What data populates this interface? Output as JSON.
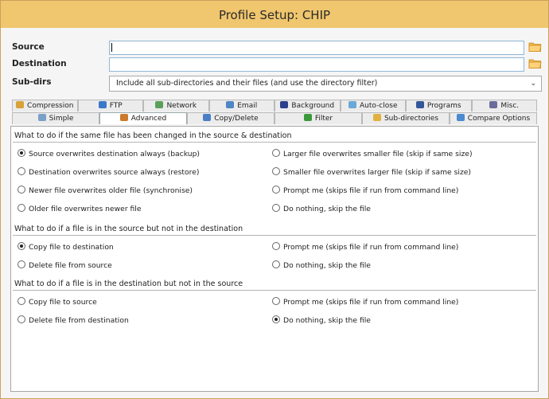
{
  "window": {
    "title": "Profile Setup: CHIP"
  },
  "fields": {
    "source_label": "Source",
    "destination_label": "Destination",
    "subdirs_label": "Sub-dirs",
    "source_value": "",
    "destination_value": "",
    "subdirs_value": "Include all sub-directories and their files (and use the directory filter)"
  },
  "tabs_top": [
    {
      "label": "Compression",
      "icon": "compression-icon"
    },
    {
      "label": "FTP",
      "icon": "ftp-icon"
    },
    {
      "label": "Network",
      "icon": "network-icon"
    },
    {
      "label": "Email",
      "icon": "email-icon"
    },
    {
      "label": "Background",
      "icon": "background-icon"
    },
    {
      "label": "Auto-close",
      "icon": "auto-close-icon"
    },
    {
      "label": "Programs",
      "icon": "programs-icon"
    },
    {
      "label": "Misc.",
      "icon": "misc-icon"
    }
  ],
  "tabs_bottom": [
    {
      "label": "Simple",
      "icon": "simple-icon"
    },
    {
      "label": "Advanced",
      "icon": "advanced-icon",
      "active": true
    },
    {
      "label": "Copy/Delete",
      "icon": "copy-delete-icon"
    },
    {
      "label": "Filter",
      "icon": "filter-icon"
    },
    {
      "label": "Sub-directories",
      "icon": "sub-directories-icon"
    },
    {
      "label": "Compare Options",
      "icon": "compare-options-icon"
    }
  ],
  "sections": [
    {
      "heading": "What to do if the same file has been changed in the source & destination",
      "options": [
        {
          "label": "Source overwrites destination always (backup)",
          "checked": true
        },
        {
          "label": "Larger file overwrites smaller file (skip if same size)",
          "checked": false
        },
        {
          "label": "Destination overwrites source always (restore)",
          "checked": false
        },
        {
          "label": "Smaller file overwrites larger file (skip if same size)",
          "checked": false
        },
        {
          "label": "Newer file overwrites older file (synchronise)",
          "checked": false
        },
        {
          "label": "Prompt me (skips file if run from command line)",
          "checked": false
        },
        {
          "label": "Older file overwrites newer file",
          "checked": false
        },
        {
          "label": "Do nothing, skip the file",
          "checked": false
        }
      ]
    },
    {
      "heading": "What to do if a file is in the source but not in the destination",
      "options": [
        {
          "label": "Copy file to destination",
          "checked": true
        },
        {
          "label": "Prompt me  (skips file if run from command line)",
          "checked": false
        },
        {
          "label": "Delete file from source",
          "checked": false
        },
        {
          "label": "Do nothing, skip the file",
          "checked": false
        }
      ]
    },
    {
      "heading": "What to do if a file is in the destination but not in the source",
      "options": [
        {
          "label": "Copy file to source",
          "checked": false
        },
        {
          "label": "Prompt me  (skips file if run from command line)",
          "checked": false
        },
        {
          "label": "Delete file from destination",
          "checked": false
        },
        {
          "label": "Do nothing, skip the file",
          "checked": true
        }
      ]
    }
  ],
  "colors": {
    "titlebar": "#f0c66e",
    "field_border": "#8fb7d6",
    "folder": "#f2b84b"
  }
}
